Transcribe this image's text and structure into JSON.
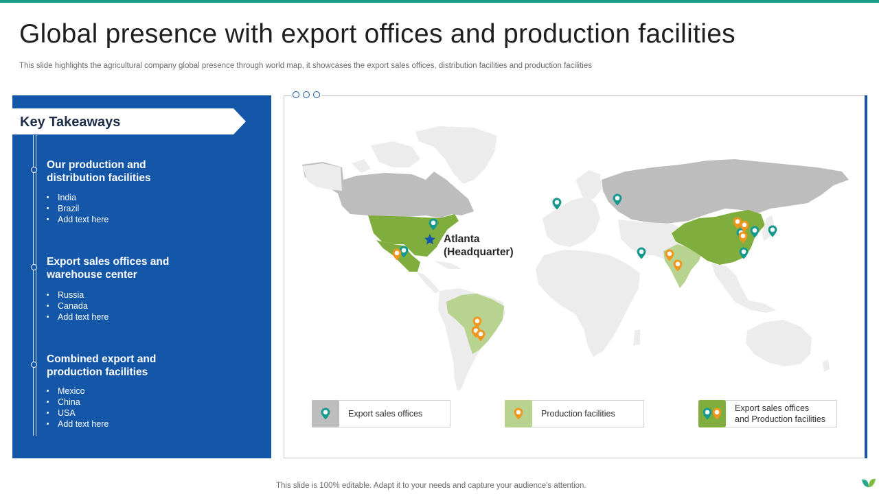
{
  "header": {
    "title": "Global presence with export offices and production facilities",
    "subtitle": "This slide highlights the agricultural company global presence through world map, it showcases the export sales offices, distribution facilities and production facilities"
  },
  "takeaways": {
    "heading": "Key Takeaways",
    "sections": [
      {
        "title": "Our production and distribution facilities",
        "items": [
          "India",
          "Brazil",
          "Add text here"
        ]
      },
      {
        "title": "Export sales offices and warehouse center",
        "items": [
          "Russia",
          "Canada",
          "Add text here"
        ]
      },
      {
        "title": "Combined export and production facilities",
        "items": [
          "Mexico",
          "China",
          "USA",
          "Add text here"
        ]
      }
    ]
  },
  "map": {
    "hq_line1": "Atlanta",
    "hq_line2": "(Headquarter)",
    "colors": {
      "export": "#bdbdbd",
      "production": "#b7d38f",
      "combined": "#7fae3f",
      "other_land": "#ececec",
      "teal_pin": "#14998c",
      "orange_pin": "#f0961c",
      "hq_star": "#1457a8"
    }
  },
  "legend": {
    "export": "Export sales offices",
    "production": "Production facilities",
    "combined_line1": "Export sales offices",
    "combined_line2": "and Production facilities"
  },
  "footer": {
    "note": "This slide is 100% editable. Adapt it to your needs and capture your audience's attention."
  }
}
